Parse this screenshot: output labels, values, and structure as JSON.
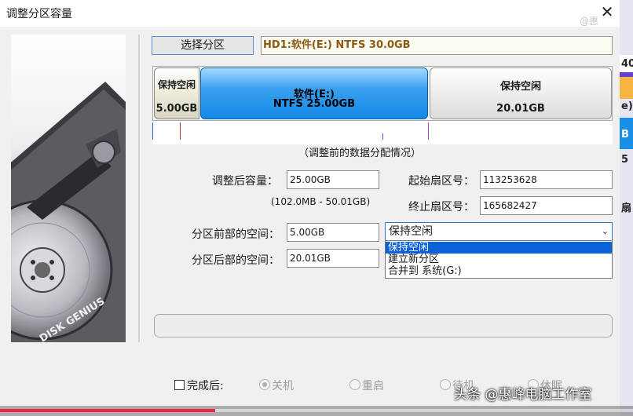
{
  "window": {
    "title": "调整分区容量",
    "close_glyph": "✕"
  },
  "watermark_top": "@惠",
  "right_edge": {
    "frag1": "40",
    "frag2": "e)",
    "frag3": "B",
    "frag4": "5",
    "frag5": "扇"
  },
  "art": {
    "brand": "DISK GENIUS"
  },
  "select_partition_button": "选择分区",
  "disk_info": "HD1:软件(E:) NTFS 30.0GB",
  "partition_map": {
    "left": {
      "name": "保持空闲",
      "size": "5.00GB"
    },
    "middle": {
      "name": "软件(E:)",
      "detail": "NTFS 25.00GB"
    },
    "right": {
      "name": "保持空闲",
      "size": "20.01GB"
    }
  },
  "map_caption": "（调整前的数据分配情况）",
  "form": {
    "new_size_label": "调整后容量：",
    "new_size_value": "25.00GB",
    "range_hint": "(102.0MB - 50.01GB)",
    "start_sector_label": "起始扇区号：",
    "start_sector_value": "113253628",
    "end_sector_label": "终止扇区号：",
    "end_sector_value": "165682427",
    "before_label": "分区前部的空间：",
    "before_value": "5.00GB",
    "after_label": "分区后部的空间：",
    "after_value": "20.01GB"
  },
  "combo": {
    "selected": "保持空闲",
    "arrow_glyph": "⌄",
    "options": [
      "保持空闲",
      "建立新分区",
      "合并到 系统(G:)"
    ],
    "highlighted_index": 0
  },
  "bottom": {
    "after_complete_label": "完成后:",
    "options": [
      "关机",
      "重启",
      "待机",
      "休眠"
    ]
  },
  "watermark_bottom": "头条 @惠峰电脑工作室",
  "video_progress": 0.34,
  "colors": {
    "accent_blue": "#1a8fe8",
    "selection_blue": "#0a62d9",
    "disk_info_text": "#8a5a10",
    "video_progress": "#e8254a"
  }
}
